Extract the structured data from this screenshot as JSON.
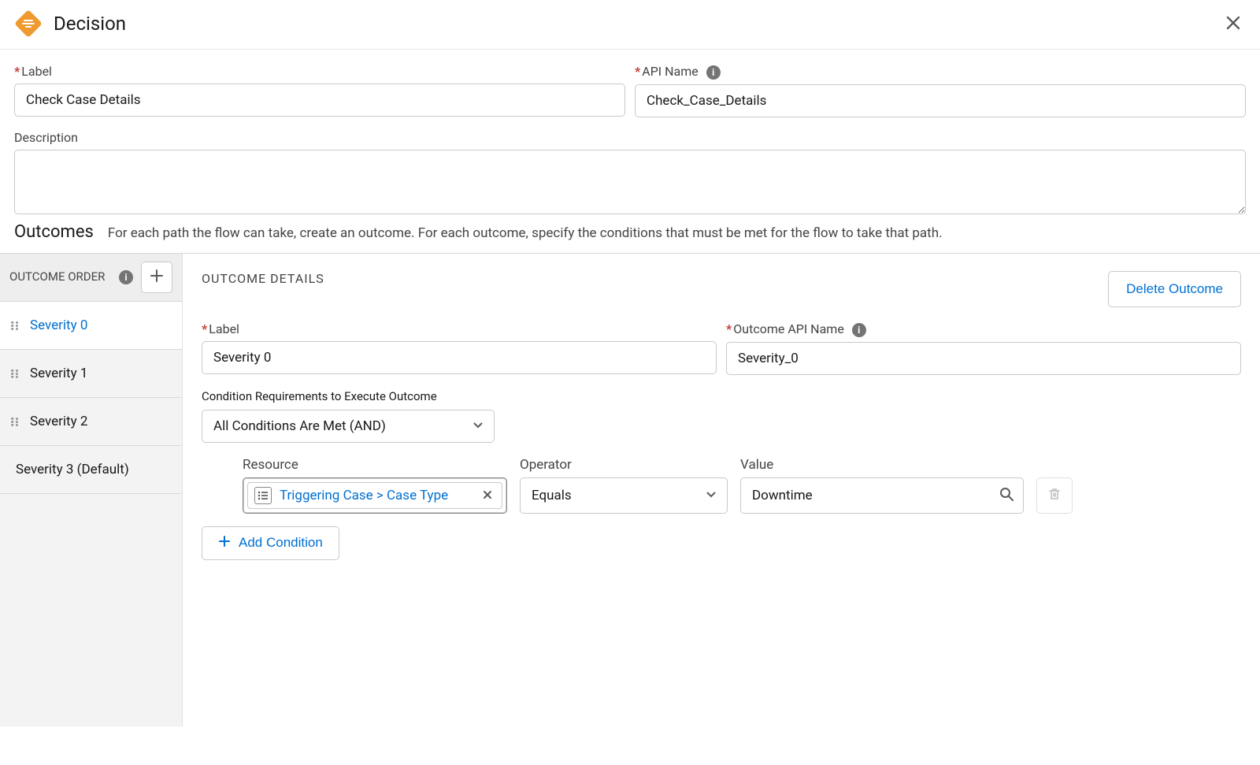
{
  "header": {
    "title": "Decision"
  },
  "top": {
    "label_label": "Label",
    "label_value": "Check Case Details",
    "api_label": "API Name",
    "api_value": "Check_Case_Details",
    "desc_label": "Description",
    "desc_value": ""
  },
  "outcomes_heading": "Outcomes",
  "outcomes_help": "For each path the flow can take, create an outcome. For each outcome, specify the conditions that must be met for the flow to take that path.",
  "sidebar": {
    "order_label": "OUTCOME ORDER",
    "items": [
      {
        "label": "Severity 0",
        "active": true,
        "draggable": true
      },
      {
        "label": "Severity 1",
        "active": false,
        "draggable": true
      },
      {
        "label": "Severity 2",
        "active": false,
        "draggable": true
      },
      {
        "label": "Severity 3 (Default)",
        "active": false,
        "draggable": false
      }
    ]
  },
  "details": {
    "title": "OUTCOME DETAILS",
    "delete_label": "Delete Outcome",
    "outcome_label_label": "Label",
    "outcome_label_value": "Severity 0",
    "outcome_api_label": "Outcome API Name",
    "outcome_api_value": "Severity_0",
    "cond_req_label": "Condition Requirements to Execute Outcome",
    "cond_req_value": "All Conditions Are Met (AND)",
    "cond": {
      "resource_label": "Resource",
      "resource_value": "Triggering Case > Case Type",
      "operator_label": "Operator",
      "operator_value": "Equals",
      "value_label": "Value",
      "value_value": "Downtime"
    },
    "add_condition_label": "Add Condition"
  }
}
